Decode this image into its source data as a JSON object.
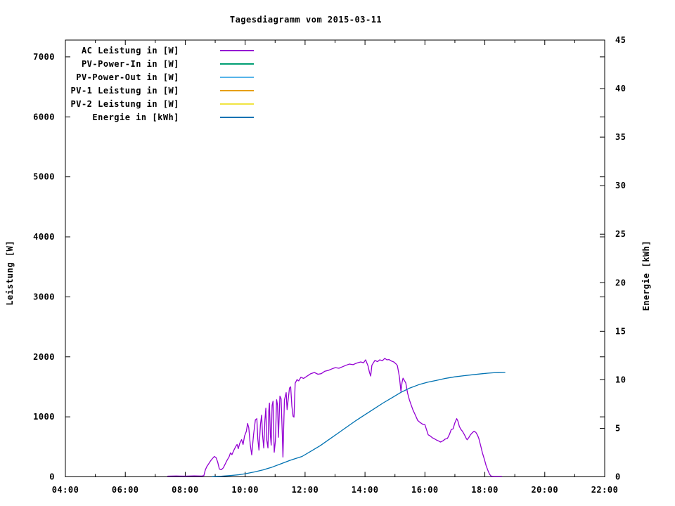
{
  "chart_data": {
    "type": "line",
    "title": "Tagesdiagramm vom 2015-03-11",
    "y1_label": "Leistung [W]",
    "y2_label": "Energie [kWh]",
    "x_range_hours": [
      4,
      22
    ],
    "x_ticks_major_hours": [
      4,
      6,
      8,
      10,
      12,
      14,
      16,
      18,
      20,
      22
    ],
    "x_ticks_minor_hours": [
      5,
      7,
      9,
      11,
      13,
      15,
      17,
      19,
      21
    ],
    "x_tick_labels": [
      "04:00",
      "06:00",
      "08:00",
      "10:00",
      "12:00",
      "14:00",
      "16:00",
      "18:00",
      "20:00",
      "22:00"
    ],
    "y1_range": [
      0,
      7280
    ],
    "y1_tick_values": [
      0,
      1000,
      2000,
      3000,
      4000,
      5000,
      6000,
      7000
    ],
    "y1_tick_labels": [
      "0",
      "1000",
      "2000",
      "3000",
      "4000",
      "5000",
      "6000",
      "7000"
    ],
    "y2_range": [
      0,
      45
    ],
    "y2_tick_values": [
      0,
      5,
      10,
      15,
      20,
      25,
      30,
      35,
      40,
      45
    ],
    "y2_tick_labels": [
      "0",
      "5",
      "10",
      "15",
      "20",
      "25",
      "30",
      "35",
      "40",
      "45"
    ],
    "grid": false,
    "legend_position": "top-left",
    "colors": {
      "foreground": "#000000",
      "background": "#ffffff"
    },
    "series": [
      {
        "name": "ac-leistung",
        "label": "AC Leistung in [W]",
        "color": "#9400d3",
        "axis": "y1",
        "points": [
          [
            7.42,
            12
          ],
          [
            7.7,
            14
          ],
          [
            8.0,
            12
          ],
          [
            8.3,
            15
          ],
          [
            8.55,
            13
          ],
          [
            8.62,
            20
          ],
          [
            8.67,
            115
          ],
          [
            8.72,
            170
          ],
          [
            8.78,
            215
          ],
          [
            8.85,
            270
          ],
          [
            8.92,
            310
          ],
          [
            8.97,
            340
          ],
          [
            9.03,
            320
          ],
          [
            9.08,
            250
          ],
          [
            9.14,
            130
          ],
          [
            9.2,
            118
          ],
          [
            9.27,
            150
          ],
          [
            9.33,
            210
          ],
          [
            9.4,
            280
          ],
          [
            9.46,
            330
          ],
          [
            9.51,
            400
          ],
          [
            9.56,
            370
          ],
          [
            9.62,
            440
          ],
          [
            9.68,
            500
          ],
          [
            9.73,
            540
          ],
          [
            9.77,
            470
          ],
          [
            9.82,
            560
          ],
          [
            9.88,
            620
          ],
          [
            9.93,
            540
          ],
          [
            9.98,
            680
          ],
          [
            10.04,
            760
          ],
          [
            10.08,
            890
          ],
          [
            10.12,
            820
          ],
          [
            10.17,
            540
          ],
          [
            10.22,
            365
          ],
          [
            10.28,
            700
          ],
          [
            10.34,
            950
          ],
          [
            10.39,
            970
          ],
          [
            10.42,
            640
          ],
          [
            10.46,
            445
          ],
          [
            10.51,
            870
          ],
          [
            10.55,
            1030
          ],
          [
            10.58,
            700
          ],
          [
            10.62,
            480
          ],
          [
            10.66,
            950
          ],
          [
            10.69,
            1145
          ],
          [
            10.72,
            620
          ],
          [
            10.76,
            480
          ],
          [
            10.79,
            1100
          ],
          [
            10.81,
            1230
          ],
          [
            10.84,
            700
          ],
          [
            10.87,
            530
          ],
          [
            10.9,
            1190
          ],
          [
            10.93,
            1260
          ],
          [
            10.97,
            410
          ],
          [
            11.01,
            600
          ],
          [
            11.05,
            1285
          ],
          [
            11.08,
            1200
          ],
          [
            11.11,
            660
          ],
          [
            11.16,
            1345
          ],
          [
            11.2,
            1300
          ],
          [
            11.24,
            700
          ],
          [
            11.26,
            330
          ],
          [
            11.31,
            1280
          ],
          [
            11.37,
            1405
          ],
          [
            11.4,
            1120
          ],
          [
            11.44,
            1300
          ],
          [
            11.48,
            1480
          ],
          [
            11.52,
            1500
          ],
          [
            11.56,
            1180
          ],
          [
            11.6,
            1010
          ],
          [
            11.63,
            995
          ],
          [
            11.67,
            1560
          ],
          [
            11.73,
            1620
          ],
          [
            11.79,
            1600
          ],
          [
            11.86,
            1660
          ],
          [
            11.95,
            1640
          ],
          [
            12.07,
            1680
          ],
          [
            12.19,
            1720
          ],
          [
            12.31,
            1740
          ],
          [
            12.43,
            1710
          ],
          [
            12.54,
            1720
          ],
          [
            12.66,
            1760
          ],
          [
            12.78,
            1775
          ],
          [
            12.9,
            1800
          ],
          [
            13.01,
            1820
          ],
          [
            13.13,
            1810
          ],
          [
            13.25,
            1835
          ],
          [
            13.37,
            1860
          ],
          [
            13.48,
            1880
          ],
          [
            13.6,
            1870
          ],
          [
            13.72,
            1895
          ],
          [
            13.86,
            1915
          ],
          [
            13.95,
            1900
          ],
          [
            14.02,
            1950
          ],
          [
            14.1,
            1850
          ],
          [
            14.15,
            1740
          ],
          [
            14.19,
            1680
          ],
          [
            14.23,
            1860
          ],
          [
            14.33,
            1940
          ],
          [
            14.42,
            1920
          ],
          [
            14.49,
            1950
          ],
          [
            14.58,
            1935
          ],
          [
            14.66,
            1975
          ],
          [
            14.73,
            1950
          ],
          [
            14.8,
            1955
          ],
          [
            14.88,
            1930
          ],
          [
            14.96,
            1915
          ],
          [
            15.04,
            1880
          ],
          [
            15.08,
            1855
          ],
          [
            15.12,
            1750
          ],
          [
            15.15,
            1660
          ],
          [
            15.2,
            1425
          ],
          [
            15.24,
            1580
          ],
          [
            15.27,
            1645
          ],
          [
            15.32,
            1600
          ],
          [
            15.36,
            1565
          ],
          [
            15.42,
            1400
          ],
          [
            15.48,
            1285
          ],
          [
            15.54,
            1200
          ],
          [
            15.6,
            1115
          ],
          [
            15.68,
            1030
          ],
          [
            15.76,
            940
          ],
          [
            15.84,
            905
          ],
          [
            15.93,
            875
          ],
          [
            16.0,
            870
          ],
          [
            16.05,
            790
          ],
          [
            16.11,
            700
          ],
          [
            16.18,
            680
          ],
          [
            16.25,
            650
          ],
          [
            16.3,
            640
          ],
          [
            16.38,
            615
          ],
          [
            16.45,
            600
          ],
          [
            16.52,
            580
          ],
          [
            16.6,
            600
          ],
          [
            16.68,
            630
          ],
          [
            16.75,
            640
          ],
          [
            16.82,
            710
          ],
          [
            16.88,
            790
          ],
          [
            16.94,
            800
          ],
          [
            17.0,
            900
          ],
          [
            17.06,
            970
          ],
          [
            17.1,
            930
          ],
          [
            17.15,
            840
          ],
          [
            17.2,
            790
          ],
          [
            17.25,
            760
          ],
          [
            17.32,
            700
          ],
          [
            17.38,
            640
          ],
          [
            17.41,
            618
          ],
          [
            17.46,
            650
          ],
          [
            17.52,
            700
          ],
          [
            17.58,
            735
          ],
          [
            17.64,
            760
          ],
          [
            17.7,
            740
          ],
          [
            17.76,
            690
          ],
          [
            17.8,
            640
          ],
          [
            17.86,
            520
          ],
          [
            17.92,
            400
          ],
          [
            17.98,
            300
          ],
          [
            18.04,
            190
          ],
          [
            18.1,
            110
          ],
          [
            18.16,
            40
          ],
          [
            18.22,
            8
          ],
          [
            18.3,
            6
          ],
          [
            18.4,
            6
          ],
          [
            18.5,
            6
          ],
          [
            18.56,
            6
          ]
        ]
      },
      {
        "name": "pv-power-in",
        "label": "PV-Power-In in [W]",
        "color": "#009e73",
        "axis": "y1",
        "points": []
      },
      {
        "name": "pv-power-out",
        "label": "PV-Power-Out in [W]",
        "color": "#56b4e9",
        "axis": "y1",
        "points": []
      },
      {
        "name": "pv1-leistung",
        "label": "PV-1 Leistung in [W]",
        "color": "#e69f00",
        "axis": "y1",
        "points": []
      },
      {
        "name": "pv2-leistung",
        "label": "PV-2 Leistung in [W]",
        "color": "#f0e442",
        "axis": "y1",
        "points": []
      },
      {
        "name": "energie",
        "label": "Energie in [kWh]",
        "color": "#0072b2",
        "axis": "y2",
        "points": [
          [
            8.9,
            0.02
          ],
          [
            9.2,
            0.06
          ],
          [
            9.5,
            0.13
          ],
          [
            9.8,
            0.22
          ],
          [
            10.0,
            0.32
          ],
          [
            10.3,
            0.5
          ],
          [
            10.6,
            0.72
          ],
          [
            10.9,
            1.0
          ],
          [
            11.2,
            1.35
          ],
          [
            11.5,
            1.7
          ],
          [
            11.9,
            2.1
          ],
          [
            12.2,
            2.65
          ],
          [
            12.5,
            3.2
          ],
          [
            12.8,
            3.85
          ],
          [
            13.1,
            4.5
          ],
          [
            13.4,
            5.15
          ],
          [
            13.7,
            5.8
          ],
          [
            14.0,
            6.4
          ],
          [
            14.3,
            7.0
          ],
          [
            14.6,
            7.6
          ],
          [
            14.9,
            8.15
          ],
          [
            15.2,
            8.7
          ],
          [
            15.5,
            9.15
          ],
          [
            15.8,
            9.5
          ],
          [
            16.1,
            9.75
          ],
          [
            16.4,
            9.95
          ],
          [
            16.7,
            10.15
          ],
          [
            17.0,
            10.3
          ],
          [
            17.3,
            10.42
          ],
          [
            17.6,
            10.52
          ],
          [
            17.9,
            10.62
          ],
          [
            18.1,
            10.68
          ],
          [
            18.3,
            10.72
          ],
          [
            18.45,
            10.74
          ],
          [
            18.67,
            10.75
          ]
        ]
      }
    ]
  }
}
